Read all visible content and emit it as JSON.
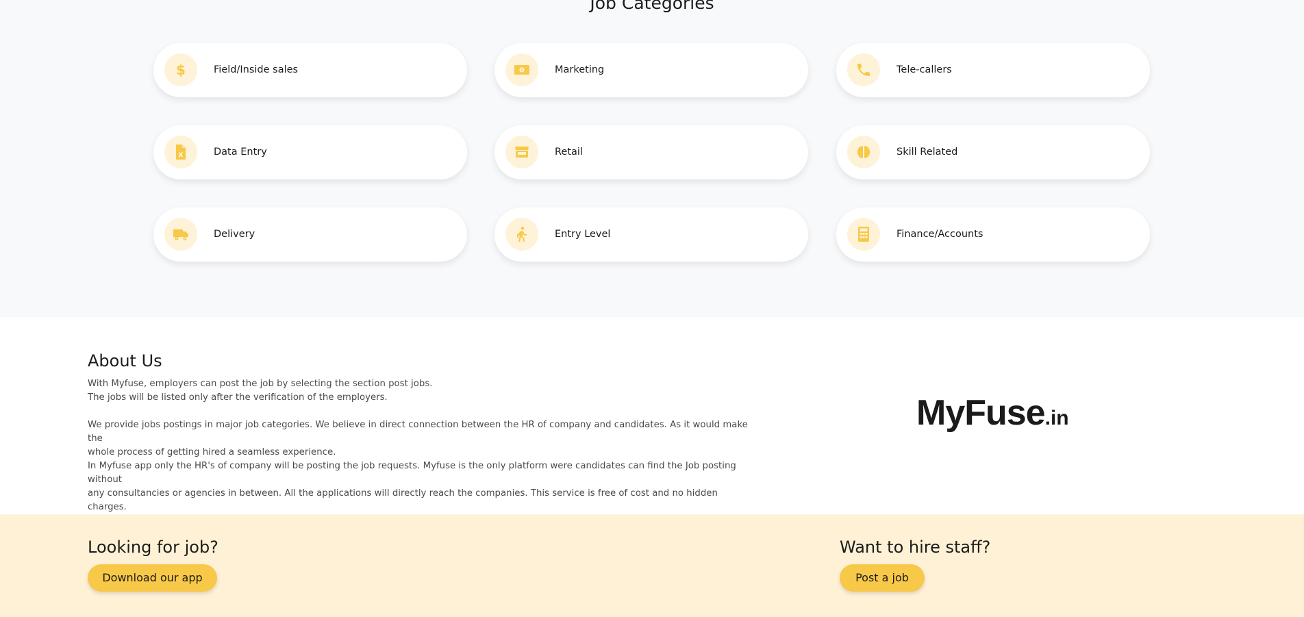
{
  "categories": {
    "title": "Job Categories",
    "items": [
      {
        "label": "Field/Inside sales",
        "icon": "dollar-icon"
      },
      {
        "label": "Marketing",
        "icon": "money-bill-icon"
      },
      {
        "label": "Tele-callers",
        "icon": "phone-icon"
      },
      {
        "label": "Data Entry",
        "icon": "excel-file-icon"
      },
      {
        "label": "Retail",
        "icon": "store-icon"
      },
      {
        "label": "Skill Related",
        "icon": "brain-icon"
      },
      {
        "label": "Delivery",
        "icon": "truck-icon"
      },
      {
        "label": "Entry Level",
        "icon": "walking-person-icon"
      },
      {
        "label": "Finance/Accounts",
        "icon": "calculator-icon"
      }
    ],
    "icon_color": "#f8c848",
    "icon_bg": "#fef3d8"
  },
  "about": {
    "title": "About Us",
    "p1_line1": "With Myfuse, employers can post the job by selecting the section post jobs.",
    "p1_line2": "The jobs will be listed only after the verification of the employers.",
    "p2_line1": "We provide jobs postings in major job categories. We believe in direct connection between the HR of company and candidates. As it would make the",
    "p2_line2": "whole process of getting hired a seamless experience.",
    "p3_line1": "In Myfuse app only the HR's of company will be posting the job requests. Myfuse is the only platform were candidates can find the Job posting without",
    "p3_line2": "any consultancies or agencies in between. All the applications will directly reach the companies. This service is free of cost and no hidden charges."
  },
  "logo": {
    "main": "MyFuse",
    "tld": ".in"
  },
  "cta": {
    "job_heading": "Looking for job?",
    "job_button": "Download our app",
    "hire_heading": "Want to hire staff?",
    "hire_button": "Post a job",
    "background": "#fef1d6",
    "button_color": "#f8c848"
  }
}
